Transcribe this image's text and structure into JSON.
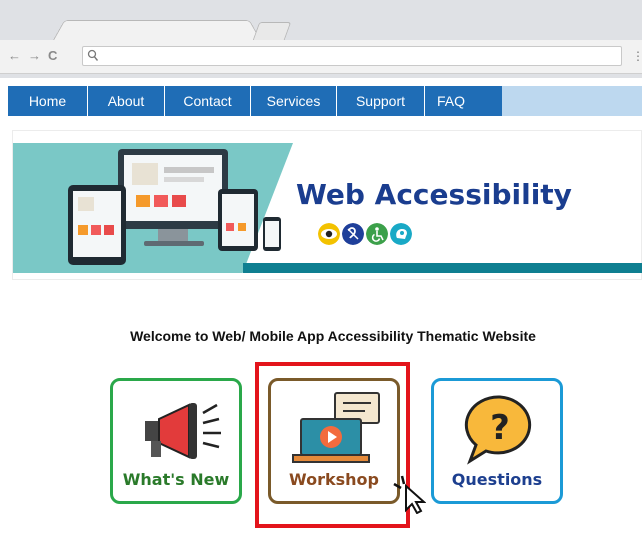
{
  "browser": {
    "back_glyph": "←",
    "forward_glyph": "→",
    "reload_glyph": "C",
    "search_glyph": "🔍",
    "menu_glyph": "⋮"
  },
  "nav": {
    "items": [
      {
        "label": "Home"
      },
      {
        "label": "About"
      },
      {
        "label": "Contact"
      },
      {
        "label": "Services"
      },
      {
        "label": "Support"
      },
      {
        "label": "FAQ"
      }
    ]
  },
  "banner": {
    "title": "Web Accessibility",
    "icons": [
      "eye-icon",
      "hearing-icon",
      "wheelchair-icon",
      "cognitive-icon"
    ]
  },
  "welcome_text": "Welcome to Web/ Mobile App Accessibility Thematic Website",
  "cards": [
    {
      "label": "What's New",
      "icon": "megaphone-icon",
      "color": "#2aa84a",
      "text_color": "#2a7a2a"
    },
    {
      "label": "Workshop",
      "icon": "laptop-chat-icon",
      "color": "#7a5a2a",
      "text_color": "#8a4a1f"
    },
    {
      "label": "Questions",
      "icon": "question-bubble-icon",
      "color": "#1b9ad6",
      "text_color": "#1d3f8f"
    }
  ],
  "colors": {
    "nav_blue": "#1f6db6",
    "highlight_red": "#e3141b",
    "banner_teal": "#7ac8c6"
  }
}
